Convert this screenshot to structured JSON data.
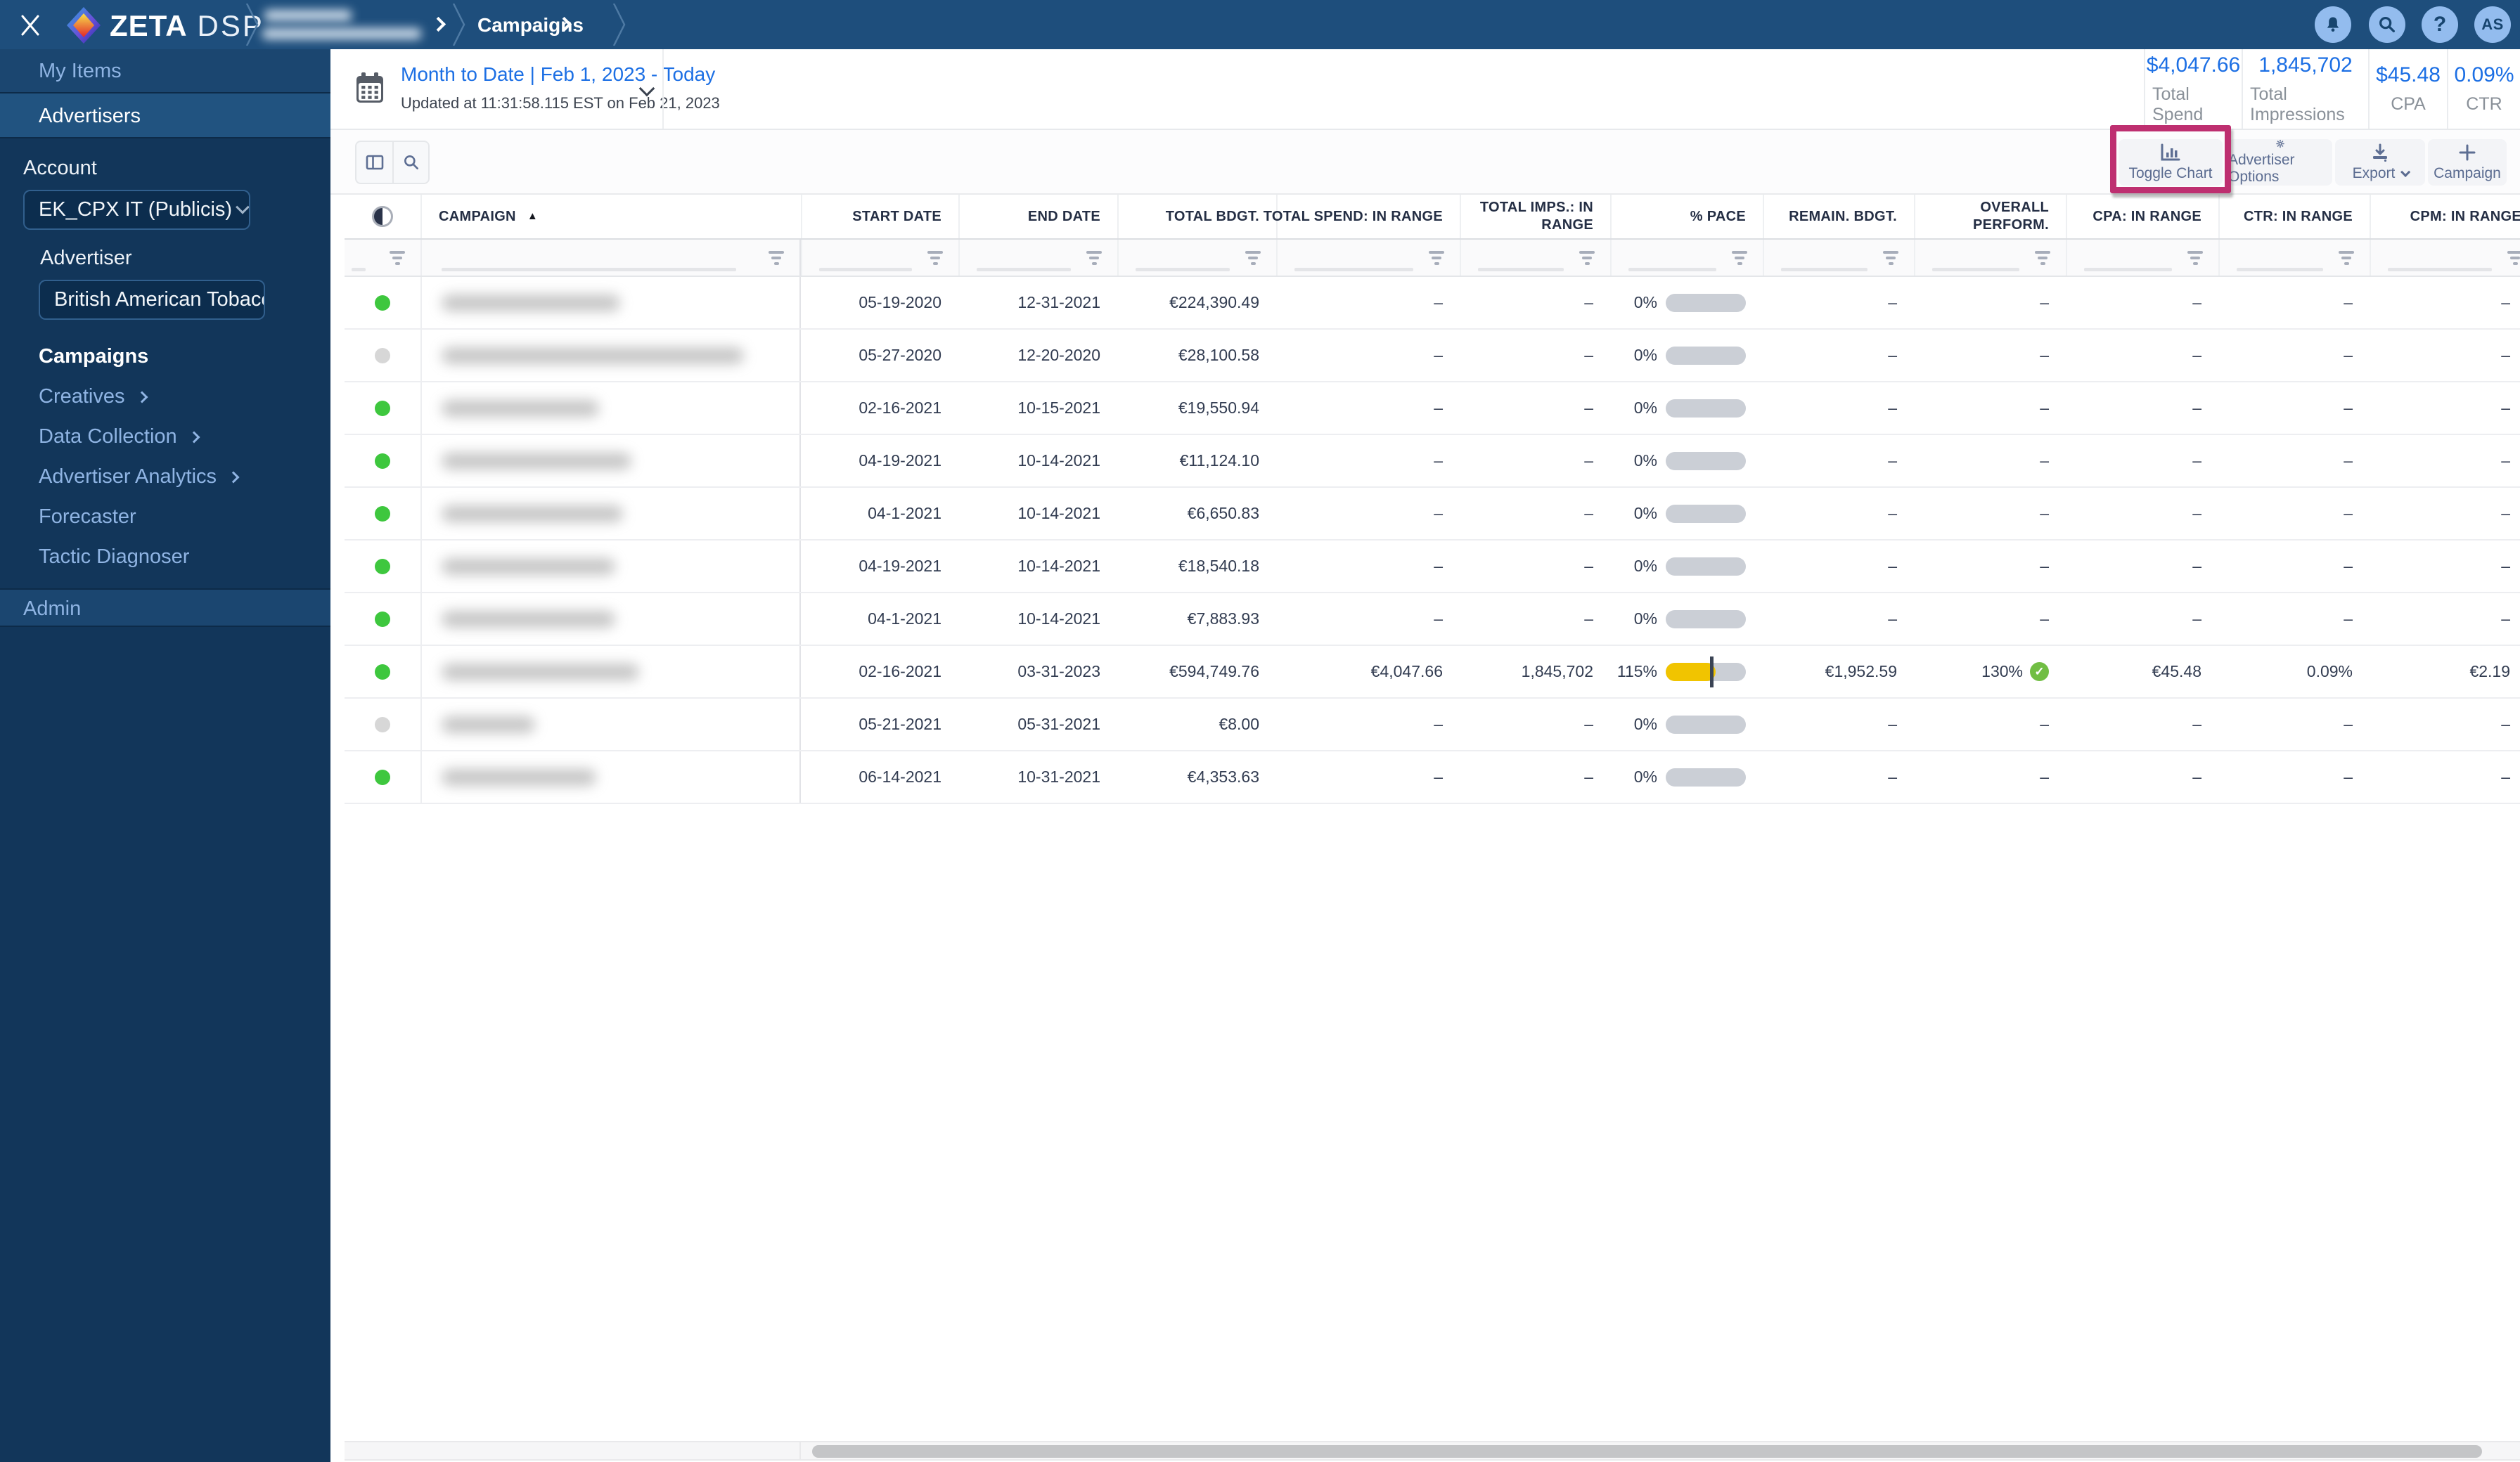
{
  "topbar": {
    "brand": {
      "zeta": "ZETA",
      "dsp": "DSP"
    },
    "breadcrumb": {
      "current": "Campaigns"
    },
    "avatar": "AS"
  },
  "sidebar": {
    "my_items": "My Items",
    "advertisers": "Advertisers",
    "account_label": "Account",
    "account_value": "EK_CPX IT (Publicis)",
    "advertiser_label": "Advertiser",
    "advertiser_value": "British American Tobacco B..",
    "items": [
      {
        "label": "Campaigns"
      },
      {
        "label": "Creatives"
      },
      {
        "label": "Data Collection"
      },
      {
        "label": "Advertiser Analytics"
      },
      {
        "label": "Forecaster"
      },
      {
        "label": "Tactic Diagnoser"
      }
    ],
    "admin": "Admin"
  },
  "header": {
    "date_range": "Month to Date | Feb 1, 2023 - Today",
    "updated": "Updated at 11:31:58.115 EST on Feb 21, 2023",
    "stats": [
      {
        "value": "$4,047.66",
        "label": "Total Spend"
      },
      {
        "value": "1,845,702",
        "label": "Total Impressions"
      },
      {
        "value": "$45.48",
        "label": "CPA"
      },
      {
        "value": "0.09%",
        "label": "CTR"
      }
    ]
  },
  "toolbar": {
    "toggle_chart": "Toggle Chart",
    "advertiser_options": "Advertiser Options",
    "export": "Export",
    "campaign": "Campaign"
  },
  "table": {
    "columns": [
      "CAMPAIGN",
      "START DATE",
      "END DATE",
      "TOTAL BDGT.",
      "TOTAL SPEND: IN RANGE",
      "TOTAL IMPS.: IN RANGE",
      "% PACE",
      "REMAIN. BDGT.",
      "OVERALL PERFORM.",
      "CPA: IN RANGE",
      "CTR: IN RANGE",
      "CPM: IN RANGE"
    ],
    "rows": [
      {
        "status": "active",
        "name_redacted_width": 254,
        "start": "05-19-2020",
        "end": "12-31-2021",
        "budget": "€224,390.49",
        "spend": "–",
        "imps": "–",
        "pace": "0%",
        "pace_fill": 0,
        "pace_tick": 0,
        "remain": "–",
        "perform": "–",
        "perform_check": false,
        "cpa": "–",
        "ctr": "–",
        "cpm": "–"
      },
      {
        "status": "inactive",
        "name_redacted_width": 430,
        "start": "05-27-2020",
        "end": "12-20-2020",
        "budget": "€28,100.58",
        "spend": "–",
        "imps": "–",
        "pace": "0%",
        "pace_fill": 0,
        "pace_tick": 0,
        "remain": "–",
        "perform": "–",
        "perform_check": false,
        "cpa": "–",
        "ctr": "–",
        "cpm": "–"
      },
      {
        "status": "active",
        "name_redacted_width": 224,
        "start": "02-16-2021",
        "end": "10-15-2021",
        "budget": "€19,550.94",
        "spend": "–",
        "imps": "–",
        "pace": "0%",
        "pace_fill": 0,
        "pace_tick": 0,
        "remain": "–",
        "perform": "–",
        "perform_check": false,
        "cpa": "–",
        "ctr": "–",
        "cpm": "–"
      },
      {
        "status": "active",
        "name_redacted_width": 270,
        "start": "04-19-2021",
        "end": "10-14-2021",
        "budget": "€11,124.10",
        "spend": "–",
        "imps": "–",
        "pace": "0%",
        "pace_fill": 0,
        "pace_tick": 0,
        "remain": "–",
        "perform": "–",
        "perform_check": false,
        "cpa": "–",
        "ctr": "–",
        "cpm": "–"
      },
      {
        "status": "active",
        "name_redacted_width": 258,
        "start": "04-1-2021",
        "end": "10-14-2021",
        "budget": "€6,650.83",
        "spend": "–",
        "imps": "–",
        "pace": "0%",
        "pace_fill": 0,
        "pace_tick": 0,
        "remain": "–",
        "perform": "–",
        "perform_check": false,
        "cpa": "–",
        "ctr": "–",
        "cpm": "–"
      },
      {
        "status": "active",
        "name_redacted_width": 247,
        "start": "04-19-2021",
        "end": "10-14-2021",
        "budget": "€18,540.18",
        "spend": "–",
        "imps": "–",
        "pace": "0%",
        "pace_fill": 0,
        "pace_tick": 0,
        "remain": "–",
        "perform": "–",
        "perform_check": false,
        "cpa": "–",
        "ctr": "–",
        "cpm": "–"
      },
      {
        "status": "active",
        "name_redacted_width": 247,
        "start": "04-1-2021",
        "end": "10-14-2021",
        "budget": "€7,883.93",
        "spend": "–",
        "imps": "–",
        "pace": "0%",
        "pace_fill": 0,
        "pace_tick": 0,
        "remain": "–",
        "perform": "–",
        "perform_check": false,
        "cpa": "–",
        "ctr": "–",
        "cpm": "–"
      },
      {
        "status": "active",
        "name_redacted_width": 281,
        "start": "02-16-2021",
        "end": "03-31-2023",
        "budget": "€594,749.76",
        "spend": "€4,047.66",
        "imps": "1,845,702",
        "pace": "115%",
        "pace_fill": 62,
        "pace_tick": 55,
        "remain": "€1,952.59",
        "perform": "130%",
        "perform_check": true,
        "cpa": "€45.48",
        "ctr": "0.09%",
        "cpm": "€2.19"
      },
      {
        "status": "inactive",
        "name_redacted_width": 133,
        "start": "05-21-2021",
        "end": "05-31-2021",
        "budget": "€8.00",
        "spend": "–",
        "imps": "–",
        "pace": "0%",
        "pace_fill": 0,
        "pace_tick": 0,
        "remain": "–",
        "perform": "–",
        "perform_check": false,
        "cpa": "–",
        "ctr": "–",
        "cpm": "–"
      },
      {
        "status": "active",
        "name_redacted_width": 220,
        "start": "06-14-2021",
        "end": "10-31-2021",
        "budget": "€4,353.63",
        "spend": "–",
        "imps": "–",
        "pace": "0%",
        "pace_fill": 0,
        "pace_tick": 0,
        "remain": "–",
        "perform": "–",
        "perform_check": false,
        "cpa": "–",
        "ctr": "–",
        "cpm": "–"
      }
    ]
  },
  "colors": {
    "accent_blue": "#1C6FE4",
    "annotation_magenta": "#BE2F70",
    "pace_yellow": "#F1C400",
    "status_green": "#3EC73E"
  }
}
